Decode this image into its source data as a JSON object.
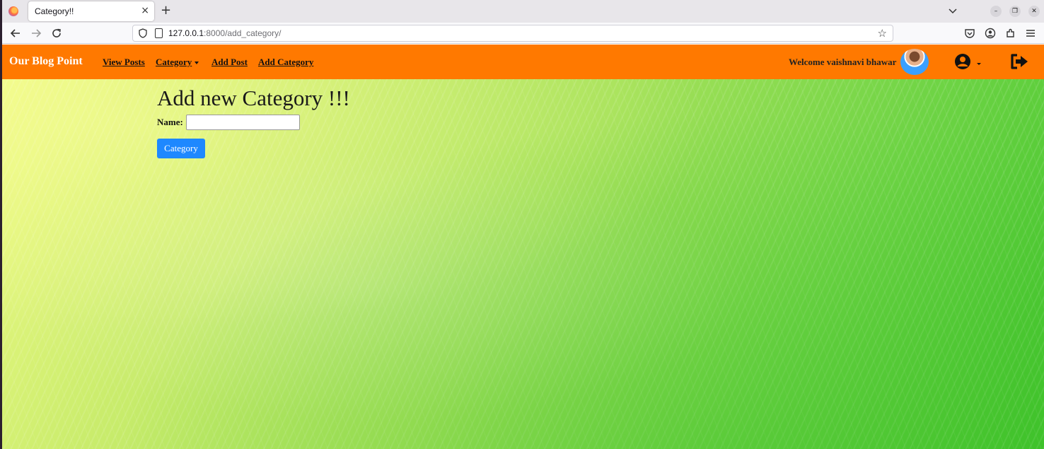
{
  "browser": {
    "tab_title": "Category!!",
    "tab_close": "×",
    "new_tab": "+",
    "url_host": "127.0.0.1",
    "url_path": ":8000/add_category/"
  },
  "site": {
    "brand": "Our Blog Point",
    "nav": {
      "view_posts": "View Posts",
      "category": "Category",
      "add_post": "Add Post",
      "add_category": "Add Category"
    },
    "welcome": "Welcome vaishnavi bhawar",
    "nav_color": "#ff7900"
  },
  "main": {
    "heading": "Add new Category !!!",
    "name_label": "Name:",
    "name_value": "",
    "submit_label": "Category",
    "button_color": "#1e88ff"
  },
  "icons": [
    "firefox-icon",
    "back-arrow-icon",
    "forward-arrow-icon",
    "reload-icon",
    "shield-icon",
    "page-icon",
    "star-icon",
    "pocket-icon",
    "account-icon",
    "extensions-icon",
    "menu-icon",
    "user-circle-icon",
    "logout-icon"
  ]
}
